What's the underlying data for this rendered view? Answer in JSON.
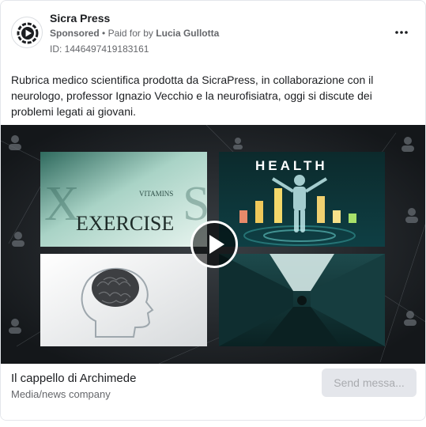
{
  "ad": {
    "page_name": "Sicra Press",
    "sponsored_label": "Sponsored",
    "separator": "•",
    "paid_for_prefix": "Paid for by",
    "paid_for_name": "Lucia Gullotta",
    "ad_id": "ID: 1446497419183161",
    "more_icon": "more-horizontal-icon",
    "body_text": "Rubrica medico scientifica prodotta da SicraPress, in collaborazione con il neurologo, professor Ignazio Vecchio e la neurofisiatra, oggi si discute dei problemi legati ai giovani."
  },
  "video": {
    "thumb_texts": {
      "vitamins": "VITAMINS",
      "exercise": "EXERCISE",
      "health": "HEALTH"
    },
    "play_icon": "play-icon"
  },
  "footer": {
    "title": "Il cappello di Archimede",
    "subtitle": "Media/news company",
    "cta_label": "Send messa..."
  },
  "colors": {
    "text_primary": "#1c1e21",
    "text_secondary": "#65676b",
    "cta_bg": "#e4e6eb",
    "cta_text": "#a9abaf"
  }
}
